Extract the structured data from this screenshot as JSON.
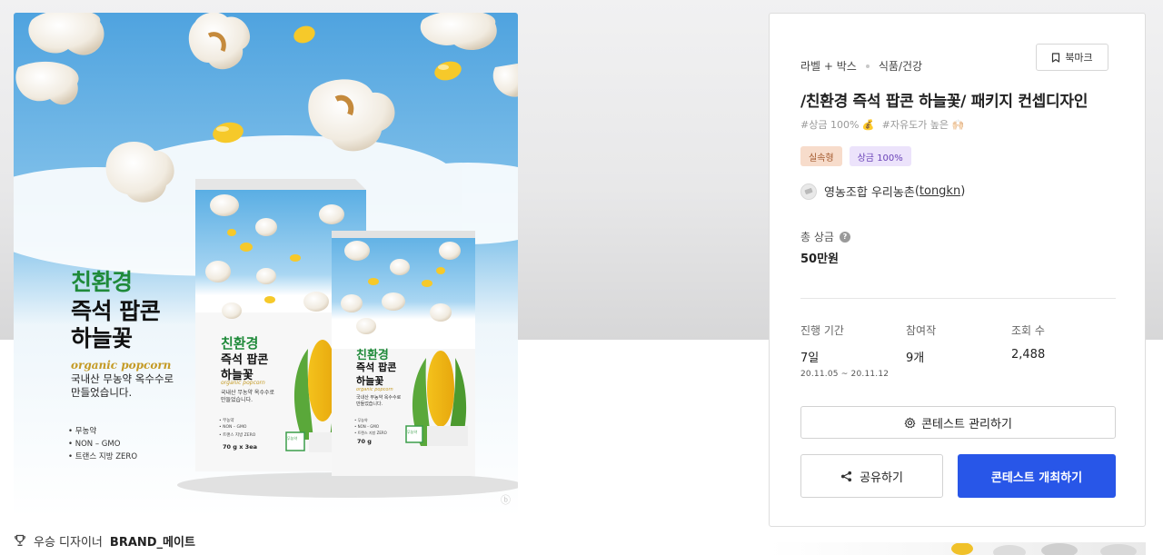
{
  "hero": {
    "headline": [
      "친환경",
      "즉석 팝콘",
      "하늘꽃"
    ],
    "tagline": "organic popcorn",
    "description": [
      "국내산 무농약 옥수수로",
      "만들었습니다."
    ],
    "bullets": [
      "• 무농약",
      "• NON – GMO",
      "• 트랜스 지방 ZERO"
    ],
    "box": {
      "headline": [
        "친환경",
        "즉석 팝콘",
        "하늘꽃"
      ],
      "tagline": "organic popcorn",
      "description": [
        "국내산 무농약 옥수수로",
        "만들었습니다."
      ],
      "bullets": [
        "• 무농약",
        "• NON – GMO",
        "• 트랜스 지방 ZERO"
      ],
      "weight": "70 g x 3ea",
      "badge": "무농약"
    },
    "pouch": {
      "headline": [
        "친환경",
        "즉석 팝콘",
        "하늘꽃"
      ],
      "tagline": "organic popcorn",
      "description": [
        "국내산 무농약 옥수수로",
        "만들었습니다."
      ],
      "bullets": [
        "• 무농약",
        "• NON – GMO",
        "• 트랜스 지방 ZERO"
      ],
      "weight": "70 g",
      "badge": "무농약"
    },
    "watermark": "ⓑ"
  },
  "award": {
    "label": "우승 디자이너",
    "name": "BRAND_메이트"
  },
  "card": {
    "category_primary": "라벨 + 박스",
    "category_secondary": "식품/건강",
    "bookmark_label": "북마크",
    "title": "/친환경 즉석 팝콘 하늘꽃/ 패키지 컨셉디자인",
    "hashtags": [
      "#상금 100% 💰",
      "#자유도가 높은 🙌🏻"
    ],
    "tags": [
      "실속형",
      "상금 100%"
    ],
    "owner_name": "영농조합 우리농촌",
    "owner_id": "tongkn",
    "prize_label": "총 상금",
    "prize_value": "50만원",
    "stats": {
      "period_label": "진행 기간",
      "period_value": "7일",
      "period_dates": "20.11.05 ~ 20.11.12",
      "participants_label": "참여작",
      "participants_value": "9개",
      "views_label": "조회 수",
      "views_value": "2,488"
    },
    "manage_label": "콘테스트 관리하기",
    "share_label": "공유하기",
    "host_label": "콘테스트 개최하기"
  },
  "colors": {
    "sky": "#5aa9e0",
    "accent_blue": "#2856e8",
    "headline_green": "#1f8a3a",
    "tag_orange_bg": "#f7dccb",
    "tag_purple_bg": "#ece3fb"
  }
}
